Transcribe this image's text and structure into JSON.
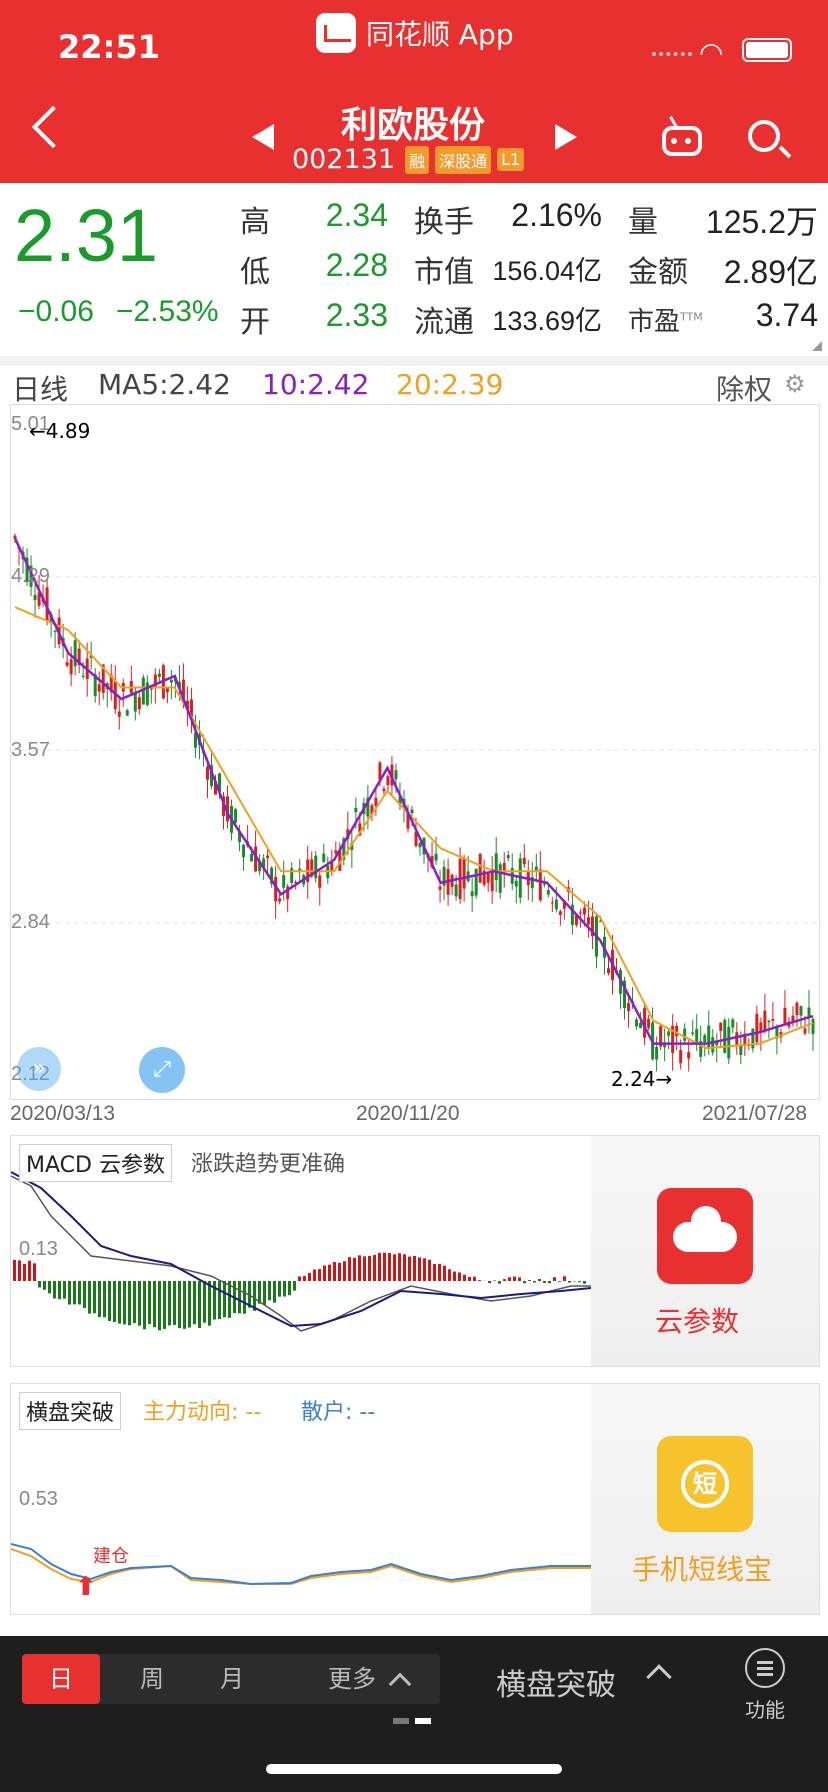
{
  "status_bar": {
    "time": "22:51",
    "app_name": "同花顺 App"
  },
  "header": {
    "stock_name": "利欧股份",
    "stock_code": "002131",
    "tags": [
      "融",
      "深股通",
      "L1"
    ],
    "icons": [
      "back-icon",
      "prev-stock-icon",
      "next-stock-icon",
      "robot-icon",
      "search-icon"
    ]
  },
  "quote": {
    "price": "2.31",
    "change": "−0.06",
    "change_pct": "−2.53%",
    "high_label": "高",
    "high": "2.34",
    "low_label": "低",
    "low": "2.28",
    "open_label": "开",
    "open": "2.33",
    "turnover_label": "换手",
    "turnover": "2.16%",
    "mktcap_label": "市值",
    "mktcap": "156.04亿",
    "float_label": "流通",
    "float": "133.69亿",
    "volume_label": "量",
    "volume": "125.2万",
    "amount_label": "金额",
    "amount": "2.89亿",
    "pe_label": "市盈",
    "pe_sup": "TTM",
    "pe": "3.74",
    "colors": {
      "down": "#1a9a2a",
      "up": "#e93030"
    }
  },
  "kline": {
    "period_label": "日线",
    "ma5": "MA5:2.42",
    "ma10": "10:2.42",
    "ma20": "20:2.39",
    "adjust_label": "除权",
    "y_ticks": [
      "5.01",
      "4.29",
      "3.57",
      "2.84",
      "2.12"
    ],
    "high_marker": "←4.89",
    "low_marker": "2.24→",
    "dates": [
      "2020/03/13",
      "2020/11/20",
      "2021/07/28"
    ],
    "colors": {
      "ma5": "#333333",
      "ma10": "#8a1fc4",
      "ma20": "#f0a020"
    }
  },
  "macd": {
    "title": "MACD 云参数",
    "desc": "涨跌趋势更准确",
    "y_tick": "0.13",
    "ad_label": "云参数"
  },
  "hengpan": {
    "title": "横盘突破",
    "main_force": "主力动向: --",
    "retail": "散户: --",
    "y_tick": "0.53",
    "signal_label": "建仓",
    "ad_label": "手机短线宝",
    "ad_icon_text": "短"
  },
  "bottom_bar": {
    "periods": [
      "日",
      "周",
      "月",
      "更多"
    ],
    "indicator": "横盘突破",
    "function_label": "功能"
  },
  "chart_data": {
    "type": "line",
    "x": [
      "2020/03/13",
      "2020/11/20",
      "2021/07/28"
    ],
    "ylim": [
      2.12,
      5.01
    ],
    "series": [
      {
        "name": "MA10",
        "values": [
          4.5,
          4.0,
          3.8,
          3.9,
          3.3,
          2.95,
          3.1,
          3.5,
          3.0,
          3.05,
          3.0,
          2.75,
          2.3,
          2.3,
          2.35,
          2.42
        ]
      },
      {
        "name": "MA20",
        "values": [
          4.2,
          4.1,
          3.85,
          3.85,
          3.45,
          3.05,
          3.05,
          3.4,
          3.15,
          3.05,
          3.05,
          2.85,
          2.4,
          2.28,
          2.3,
          2.39
        ]
      }
    ]
  }
}
